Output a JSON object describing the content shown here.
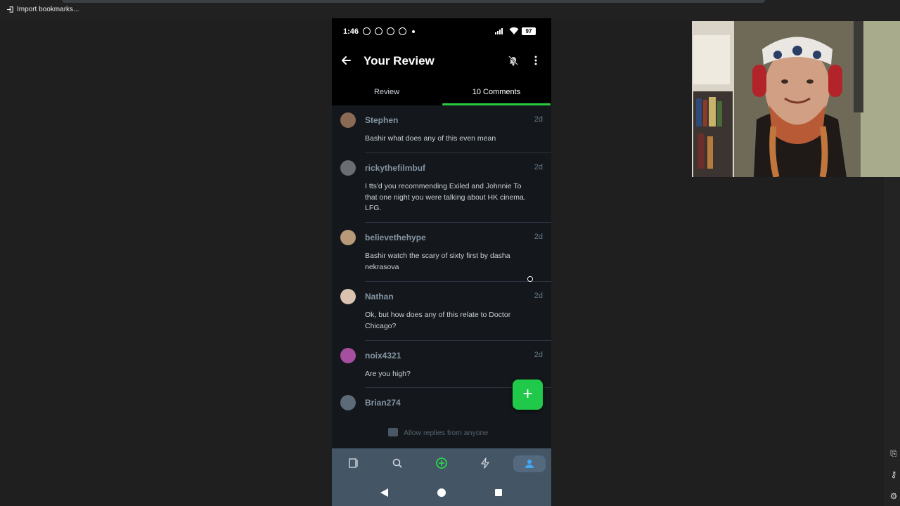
{
  "browser": {
    "bookmark_label": "Import bookmarks..."
  },
  "status_bar": {
    "time": "1:46",
    "battery": "97"
  },
  "app_bar": {
    "title": "Your Review"
  },
  "tabs": [
    {
      "label": "Review",
      "active": false
    },
    {
      "label": "10 Comments",
      "active": true
    }
  ],
  "comments": [
    {
      "user": "Stephen",
      "when": "2d",
      "text": "Bashir what does any of this even mean",
      "avatar_color": "#8a6a55"
    },
    {
      "user": "rickythefilmbuf",
      "when": "2d",
      "text": "I tts'd you recommending Exiled and Johnnie To that one night you were talking about HK cinema. LFG.",
      "avatar_color": "#6a6e72"
    },
    {
      "user": "believethehype",
      "when": "2d",
      "text": "Bashir watch the scary of sixty first by dasha nekrasova",
      "avatar_color": "#b89a78"
    },
    {
      "user": "Nathan",
      "when": "2d",
      "text": "Ok, but how does any of this relate to Doctor Chicago?",
      "avatar_color": "#d9c2b0"
    },
    {
      "user": "noix4321",
      "when": "2d",
      "text": "Are you high?",
      "avatar_color": "#a64fa0"
    },
    {
      "user": "Brian274",
      "when": "",
      "text": "",
      "avatar_color": "#5d6a78"
    }
  ],
  "fab_label": "+",
  "replies_label": "Allow replies from anyone",
  "bottom_nav": [
    {
      "icon": "films-icon",
      "active": false
    },
    {
      "icon": "search-icon",
      "active": false
    },
    {
      "icon": "add-circle-icon",
      "active": false
    },
    {
      "icon": "activity-icon",
      "active": false
    },
    {
      "icon": "profile-icon",
      "active": true
    }
  ],
  "colors": {
    "accent": "#27c93f",
    "list_bg": "#14181c",
    "nav_bg": "#445566"
  }
}
